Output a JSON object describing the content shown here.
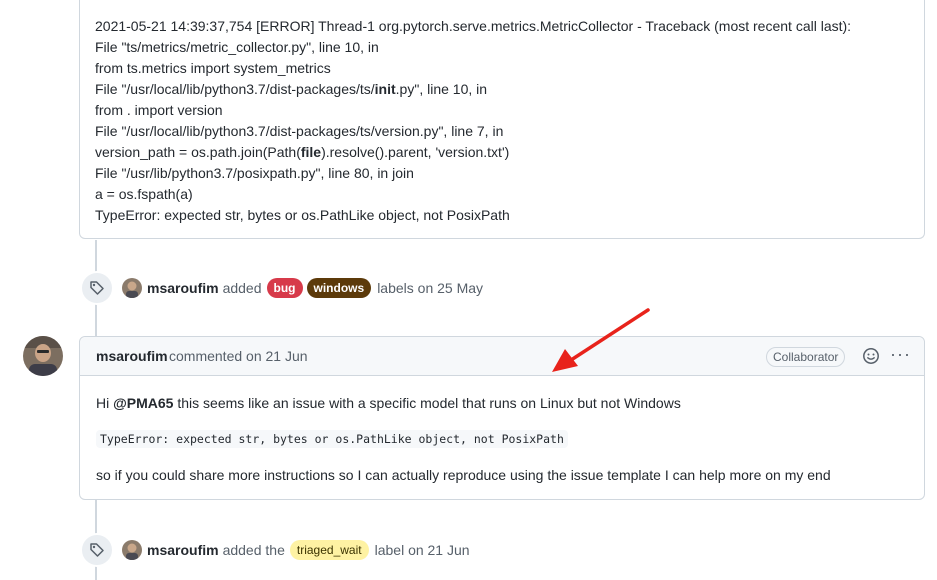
{
  "traceback_lines": [
    "2021-05-21 14:39:37,754 [ERROR] Thread-1 org.pytorch.serve.metrics.MetricCollector - Traceback (most recent call last):",
    "File \"ts/metrics/metric_collector.py\", line 10, in",
    "from ts.metrics import system_metrics",
    "File \"/usr/local/lib/python3.7/dist-packages/ts/",
    "init",
    ".py\", line 10, in",
    "from . import version",
    "File \"/usr/local/lib/python3.7/dist-packages/ts/version.py\", line 7, in",
    "version_path = os.path.join(Path(",
    "file",
    ").resolve().parent, 'version.txt')",
    "File \"/usr/lib/python3.7/posixpath.py\", line 80, in join",
    "a = os.fspath(a)",
    "TypeError: expected str, bytes or os.PathLike object, not PosixPath"
  ],
  "event1": {
    "actor": "msaroufim",
    "action": "added",
    "labels": [
      "bug",
      "windows"
    ],
    "suffix": "labels on 25 May"
  },
  "comment": {
    "author": "msaroufim",
    "meta": "commented on 21 Jun",
    "role_badge": "Collaborator",
    "greeting": "Hi",
    "mention": "@PMA65",
    "text1": "this seems like an issue with a specific model that runs on Linux but not Windows",
    "code": "TypeError: expected str, bytes or os.PathLike object, not PosixPath",
    "text2": "so if you could share more instructions so I can actually reproduce using the issue template I can help more on my end",
    "more_glyph": "···"
  },
  "event2": {
    "actor": "msaroufim",
    "action": "added the",
    "label": "triaged_wait",
    "suffix": "label on 21 Jun"
  },
  "colors": {
    "bug": "#d73a4a",
    "windows": "#5c3a0a",
    "triaged_wait": "#fef2a3",
    "arrow": "#e8231b"
  }
}
